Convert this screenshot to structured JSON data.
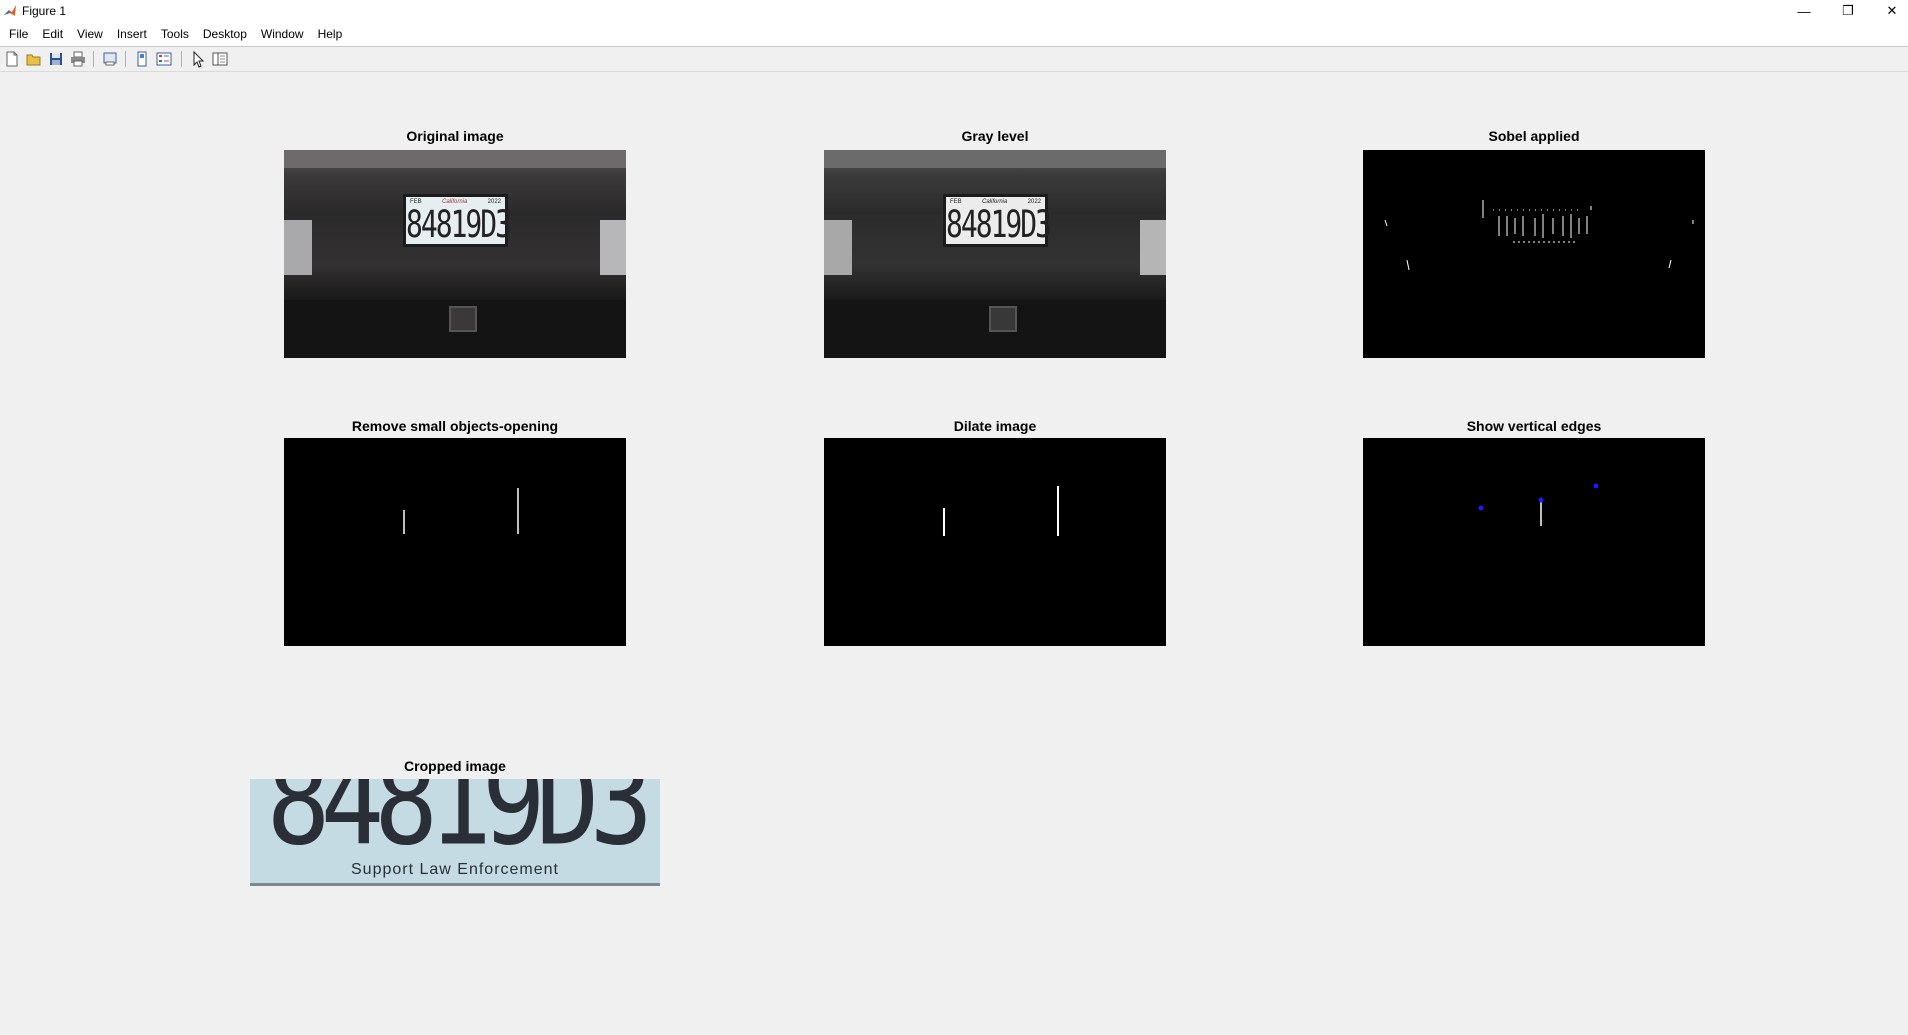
{
  "window": {
    "title": "Figure 1",
    "minimize_glyph": "—",
    "restore_glyph": "❐",
    "close_glyph": "✕"
  },
  "menu": [
    "File",
    "Edit",
    "View",
    "Insert",
    "Tools",
    "Desktop",
    "Window",
    "Help"
  ],
  "toolbar_icons": [
    "new-figure-icon",
    "open-file-icon",
    "save-icon",
    "print-icon",
    "print-preview-icon",
    "link-plot-icon",
    "insert-legend-icon",
    "pointer-icon",
    "property-inspector-icon"
  ],
  "panels": {
    "original": {
      "title": "Original image"
    },
    "gray": {
      "title": "Gray level"
    },
    "sobel": {
      "title": "Sobel applied"
    },
    "opening": {
      "title": "Remove small objects-opening"
    },
    "dilate": {
      "title": "Dilate image"
    },
    "vertical": {
      "title": "Show vertical edges"
    },
    "cropped": {
      "title": "Cropped image"
    }
  },
  "plate": {
    "number": "84819D3",
    "month": "FEB",
    "state": "California",
    "year": "2022",
    "tagline": "Support Law Enforcement"
  },
  "colors": {
    "background": "#f0f0f0",
    "marker_blue": "#1a1aff"
  }
}
